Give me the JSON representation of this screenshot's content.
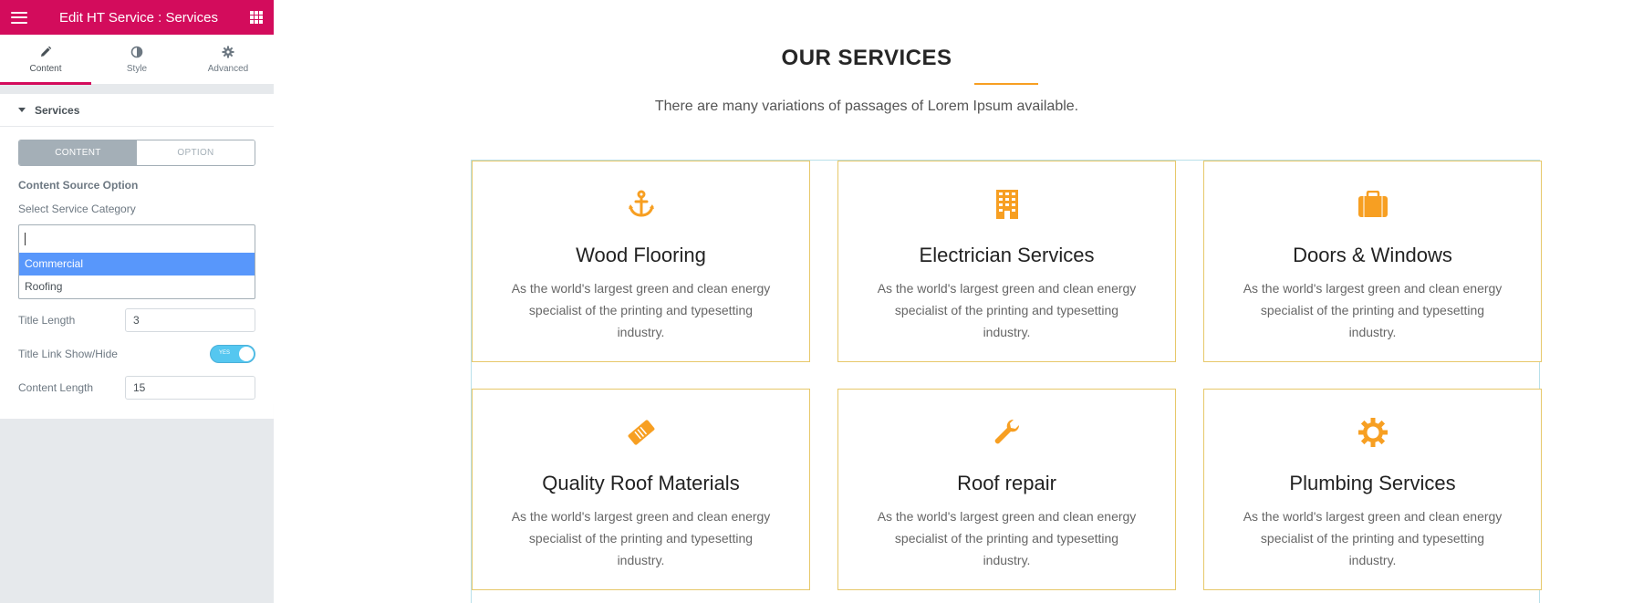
{
  "sidebar": {
    "title": "Edit HT Service : Services",
    "tabs": [
      {
        "label": "Content",
        "icon": "pencil-icon"
      },
      {
        "label": "Style",
        "icon": "half-circle-icon"
      },
      {
        "label": "Advanced",
        "icon": "gear-icon"
      }
    ],
    "section_title": "Services",
    "switcher": {
      "content": "CONTENT",
      "option": "OPTION"
    },
    "content_source_label": "Content Source Option",
    "select_category_label": "Select Service Category",
    "dropdown": {
      "input_value": "",
      "options": [
        "Commercial",
        "Roofing"
      ],
      "highlighted": "Commercial"
    },
    "title_length_label": "Title Length",
    "title_length_value": "3",
    "title_link_label": "Title Link Show/Hide",
    "toggle_text": "YES",
    "content_length_label": "Content Length",
    "content_length_value": "15"
  },
  "page": {
    "heading": "OUR SERVICES",
    "subtitle": "There are many variations of passages of Lorem Ipsum available.",
    "accent_color": "#f79f22",
    "cards": [
      {
        "title": "Wood Flooring",
        "icon": "anchor-icon",
        "desc": "As the world's largest green and clean energy specialist of the printing and typesetting industry."
      },
      {
        "title": "Electrician Services",
        "icon": "building-icon",
        "desc": "As the world's largest green and clean energy specialist of the printing and typesetting industry."
      },
      {
        "title": "Doors & Windows",
        "icon": "briefcase-icon",
        "desc": "As the world's largest green and clean energy specialist of the printing and typesetting industry."
      },
      {
        "title": "Quality Roof Materials",
        "icon": "ticket-icon",
        "desc": "As the world's largest green and clean energy specialist of the printing and typesetting industry."
      },
      {
        "title": "Roof repair",
        "icon": "wrench-icon",
        "desc": "As the world's largest green and clean energy specialist of the printing and typesetting industry."
      },
      {
        "title": "Plumbing Services",
        "icon": "gear-icon",
        "desc": "As the world's largest green and clean energy specialist of the printing and typesetting industry."
      }
    ]
  }
}
